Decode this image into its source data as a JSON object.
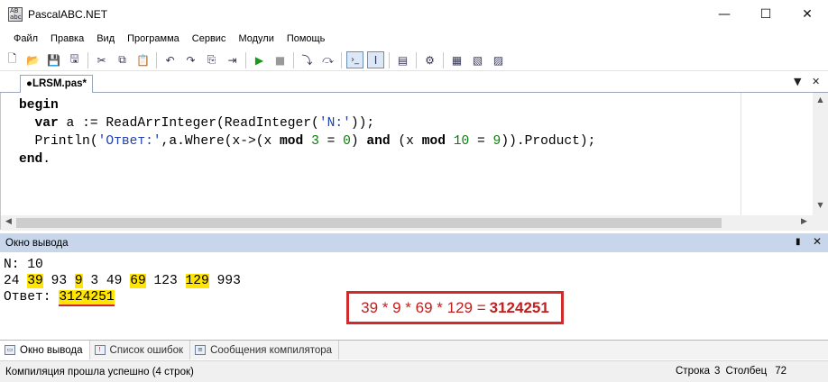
{
  "window": {
    "icon_text": "AB abc",
    "title": "PascalABC.NET",
    "minimize_glyph": "—",
    "maximize_glyph": "☐",
    "close_glyph": "✕"
  },
  "menu": [
    "Файл",
    "Правка",
    "Вид",
    "Программа",
    "Сервис",
    "Модули",
    "Помощь"
  ],
  "toolbar": {
    "buttons": [
      {
        "name": "new-file-icon",
        "glyph": "🗋"
      },
      {
        "name": "open-file-icon",
        "glyph": "📂"
      },
      {
        "name": "save-icon",
        "glyph": "💾"
      },
      {
        "name": "save-all-icon",
        "glyph": "🖫"
      },
      {
        "name": "cut-icon",
        "glyph": "✂"
      },
      {
        "name": "copy-icon",
        "glyph": "⧉"
      },
      {
        "name": "paste-icon",
        "glyph": "📋"
      },
      {
        "name": "undo-icon",
        "glyph": "↶"
      },
      {
        "name": "redo-icon",
        "glyph": "↷"
      },
      {
        "name": "find-icon",
        "glyph": "⎘"
      },
      {
        "name": "replace-icon",
        "glyph": "⇥"
      },
      {
        "name": "run-icon",
        "glyph": "▶"
      },
      {
        "name": "stop-icon",
        "glyph": "■"
      },
      {
        "name": "step-into-icon",
        "glyph": "⤵"
      },
      {
        "name": "step-over-icon",
        "glyph": "⤼"
      },
      {
        "name": "console-icon",
        "glyph": "›_"
      },
      {
        "name": "input-icon",
        "glyph": "I"
      },
      {
        "name": "form-icon",
        "glyph": "▤"
      },
      {
        "name": "debug-icon",
        "glyph": "⚙"
      },
      {
        "name": "doc-icon",
        "glyph": "▦"
      },
      {
        "name": "help-icon",
        "glyph": "▧"
      },
      {
        "name": "about-icon",
        "glyph": "▨"
      }
    ]
  },
  "tabs": {
    "active_file": "●LRSM.pas*",
    "dropdown_glyph": "▼",
    "close_glyph": "✕"
  },
  "editor": {
    "line1_kw": "begin",
    "line2_kw": "var",
    "line2_a": " a := ReadArrInteger(ReadInteger(",
    "line2_str": "'N:'",
    "line2_b": "));",
    "line3_a": "Println(",
    "line3_str": "'Ответ:'",
    "line3_b": ",a.Where(x->(x ",
    "line3_kw1": "mod",
    "line3_c": " ",
    "line3_num1": "3",
    "line3_d": " = ",
    "line3_num2": "0",
    "line3_e": ") ",
    "line3_kw2": "and",
    "line3_f": " (x ",
    "line3_kw3": "mod",
    "line3_g": " ",
    "line3_num3": "10",
    "line3_h": " = ",
    "line3_num4": "9",
    "line3_i": ")).Product);",
    "line4_kw": "end",
    "line4_dot": "."
  },
  "output_panel": {
    "title": "Окно вывода",
    "pin_glyph": "📌",
    "close_glyph": "✕",
    "line1": "N: 10",
    "numbers": [
      "24",
      "39",
      "93",
      "9",
      "3",
      "49",
      "69",
      "123",
      "129",
      "993"
    ],
    "highlighted": [
      false,
      true,
      false,
      true,
      false,
      false,
      true,
      false,
      true,
      false
    ],
    "answer_label": "Ответ: ",
    "answer_value": "3124251"
  },
  "annotation": {
    "expression": "39 * 9 * 69 * 129 =",
    "result": "3124251"
  },
  "bottom_tabs": [
    {
      "label": "Окно вывода",
      "active": true
    },
    {
      "label": "Список ошибок",
      "active": false
    },
    {
      "label": "Сообщения компилятора",
      "active": false
    }
  ],
  "status": {
    "message": "Компиляция прошла успешно (4 строк)",
    "row_label": "Строка",
    "row_value": "3",
    "col_label": "Столбец",
    "col_value": "72"
  },
  "colors": {
    "highlight": "#ffe500",
    "annotation_red": "#d02a2a",
    "panel_header": "#c7d6ea",
    "string_blue": "#1f3fb0",
    "number_green": "#0a7d0a"
  }
}
